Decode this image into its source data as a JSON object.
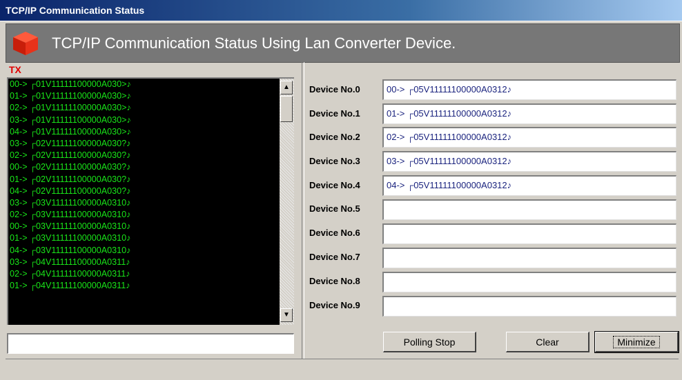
{
  "window": {
    "title": "TCP/IP Communication Status"
  },
  "banner": {
    "heading": "TCP/IP Communication Status Using Lan Converter Device."
  },
  "tx": {
    "label": "TX",
    "lines": [
      "00-> ┌01V11111100000A030>♪",
      "01-> ┌01V11111100000A030>♪",
      "02-> ┌01V11111100000A030>♪",
      "03-> ┌01V11111100000A030>♪",
      "04-> ┌01V11111100000A030>♪",
      "03-> ┌02V11111100000A030?♪",
      "02-> ┌02V11111100000A030?♪",
      "00-> ┌02V11111100000A030?♪",
      "01-> ┌02V11111100000A030?♪",
      "04-> ┌02V11111100000A030?♪",
      "03-> ┌03V11111100000A0310♪",
      "02-> ┌03V11111100000A0310♪",
      "00-> ┌03V11111100000A0310♪",
      "01-> ┌03V11111100000A0310♪",
      "04-> ┌03V11111100000A0310♪",
      "03-> ┌04V11111100000A0311♪",
      "02-> ┌04V11111100000A0311♪",
      "01-> ┌04V11111100000A0311♪"
    ],
    "input_value": ""
  },
  "devices": [
    {
      "label": "Device No.0",
      "value": "00-> ┌05V11111100000A0312♪"
    },
    {
      "label": "Device No.1",
      "value": "01-> ┌05V11111100000A0312♪"
    },
    {
      "label": "Device No.2",
      "value": "02-> ┌05V11111100000A0312♪"
    },
    {
      "label": "Device No.3",
      "value": "03-> ┌05V11111100000A0312♪"
    },
    {
      "label": "Device No.4",
      "value": "04-> ┌05V11111100000A0312♪"
    },
    {
      "label": "Device No.5",
      "value": ""
    },
    {
      "label": "Device No.6",
      "value": ""
    },
    {
      "label": "Device No.7",
      "value": ""
    },
    {
      "label": "Device No.8",
      "value": ""
    },
    {
      "label": "Device No.9",
      "value": ""
    }
  ],
  "buttons": {
    "polling_stop": "Polling Stop",
    "clear": "Clear",
    "minimize": "Minimize"
  },
  "icons": {
    "logo": "red-cube-icon",
    "scroll_up": "arrow-up-icon",
    "scroll_down": "arrow-down-icon"
  },
  "colors": {
    "log_text": "#19e619",
    "log_bg": "#000000",
    "tx_label": "#e00000",
    "banner_bg": "#777777"
  }
}
